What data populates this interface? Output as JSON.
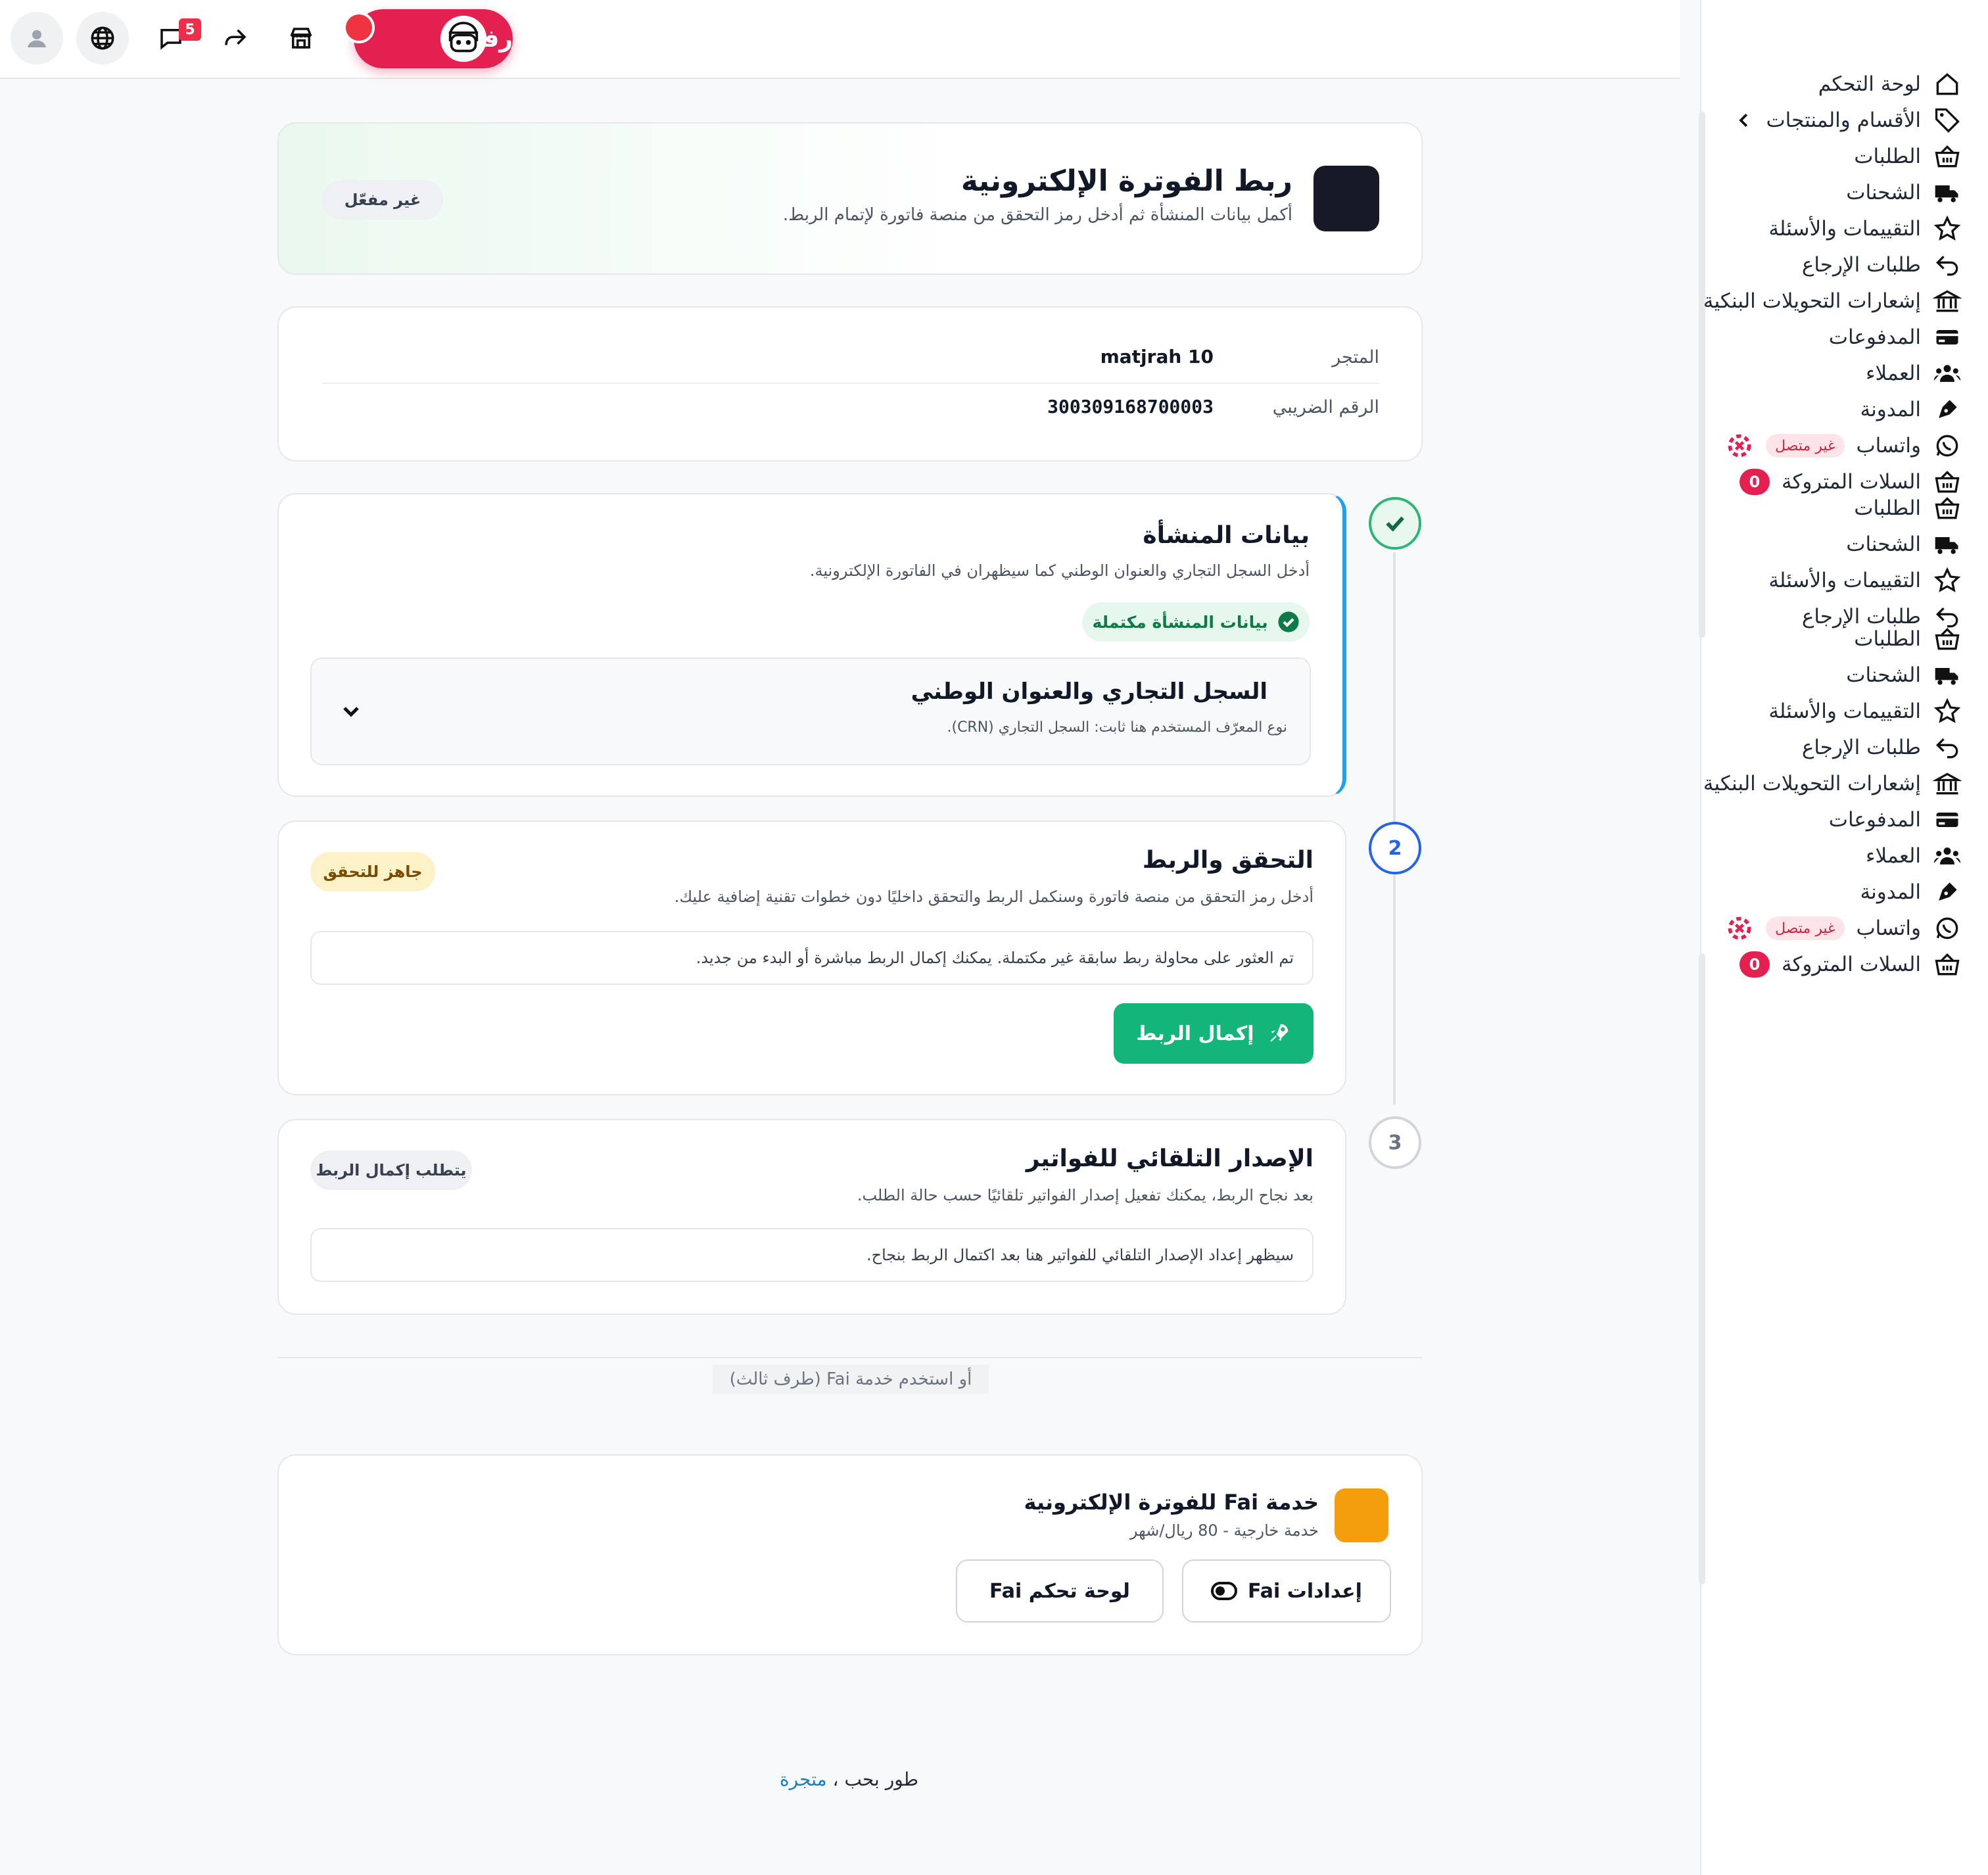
{
  "topbar": {
    "notifications_count": "5",
    "rafiq_label": "رفيق"
  },
  "sidebar": {
    "items": [
      {
        "label": "لوحة التحكم",
        "icon": "home-icon"
      },
      {
        "label": "الأقسام والمنتجات",
        "icon": "tag-icon"
      },
      {
        "label": "الطلبات",
        "icon": "basket-icon"
      },
      {
        "label": "الشحنات",
        "icon": "truck-icon"
      },
      {
        "label": "التقييمات والأسئلة",
        "icon": "star-icon"
      },
      {
        "label": "طلبات الإرجاع",
        "icon": "return-icon"
      },
      {
        "label": "إشعارات التحويلات البنكية",
        "icon": "bank-icon"
      },
      {
        "label": "المدفوعات",
        "icon": "card-icon"
      },
      {
        "label": "العملاء",
        "icon": "users-icon"
      },
      {
        "label": "المدونة",
        "icon": "blog-icon"
      },
      {
        "label": "واتساب",
        "icon": "whatsapp-icon",
        "status": "غير متصل"
      },
      {
        "label": "السلات المتروكة",
        "icon": "basket-icon",
        "badge": "0"
      },
      {
        "label": "الطلبات",
        "icon": "basket-icon"
      },
      {
        "label": "الشحنات",
        "icon": "truck-icon"
      },
      {
        "label": "التقييمات والأسئلة",
        "icon": "star-icon"
      },
      {
        "label": "طلبات الإرجاع",
        "icon": "return-icon"
      },
      {
        "label": "الطلبات",
        "icon": "basket-icon"
      },
      {
        "label": "الشحنات",
        "icon": "truck-icon"
      },
      {
        "label": "التقييمات والأسئلة",
        "icon": "star-icon"
      },
      {
        "label": "طلبات الإرجاع",
        "icon": "return-icon"
      },
      {
        "label": "إشعارات التحويلات البنكية",
        "icon": "bank-icon"
      },
      {
        "label": "المدفوعات",
        "icon": "card-icon"
      },
      {
        "label": "العملاء",
        "icon": "users-icon"
      },
      {
        "label": "المدونة",
        "icon": "blog-icon"
      },
      {
        "label": "واتساب",
        "icon": "whatsapp-icon",
        "status": "غير متصل"
      },
      {
        "label": "السلات المتروكة",
        "icon": "basket-icon",
        "badge": "0"
      }
    ]
  },
  "header": {
    "title": "ربط الفوترة الإلكترونية",
    "subtitle": "أكمل بيانات المنشأة ثم أدخل رمز التحقق من منصة فاتورة لإتمام الربط.",
    "status": "غير مفعّل"
  },
  "store_info": {
    "store_label": "المتجر",
    "store_value": "matjrah 10",
    "tax_label": "الرقم الضريبي",
    "tax_value": "300309168700003"
  },
  "steps": [
    {
      "number": "1",
      "state": "done",
      "title": "بيانات المنشأة",
      "subtitle": "أدخل السجل التجاري والعنوان الوطني كما سيظهران في الفاتورة الإلكترونية.",
      "status": "بيانات المنشأة مكتملة",
      "section_title": "السجل التجاري والعنوان الوطني",
      "section_subtitle": "نوع المعرّف المستخدم هنا ثابت: السجل التجاري (CRN)."
    },
    {
      "number": "2",
      "state": "active",
      "title": "التحقق والربط",
      "subtitle": "أدخل رمز التحقق من منصة فاتورة وسنكمل الربط والتحقق داخليًا دون خطوات تقنية إضافية عليك.",
      "status": "جاهز للتحقق",
      "message": "تم العثور على محاولة ربط سابقة غير مكتملة. يمكنك إكمال الربط مباشرة أو البدء من جديد.",
      "button": "إكمال الربط"
    },
    {
      "number": "3",
      "state": "idle",
      "title": "الإصدار التلقائي للفواتير",
      "subtitle": "بعد نجاح الربط، يمكنك تفعيل إصدار الفواتير تلقائيًا حسب حالة الطلب.",
      "status": "يتطلب إكمال الربط",
      "message": "سيظهر إعداد الإصدار التلقائي للفواتير هنا بعد اكتمال الربط بنجاح."
    }
  ],
  "divider_text": "أو استخدم خدمة Fai (طرف ثالث)",
  "fai": {
    "title": "خدمة Fai للفوترة الإلكترونية",
    "subtitle": "خدمة خارجية - 80 ريال/شهر",
    "settings_button": "إعدادات Fai",
    "dashboard_button": "لوحة تحكم Fai"
  },
  "footer": {
    "prefix": "طور بحب ،",
    "link": "متجرة"
  },
  "colors": {
    "primary_green": "#14b579",
    "brand_red": "#e3204f",
    "step_active_blue": "#2563eb",
    "fai_orange": "#f59e0b"
  }
}
